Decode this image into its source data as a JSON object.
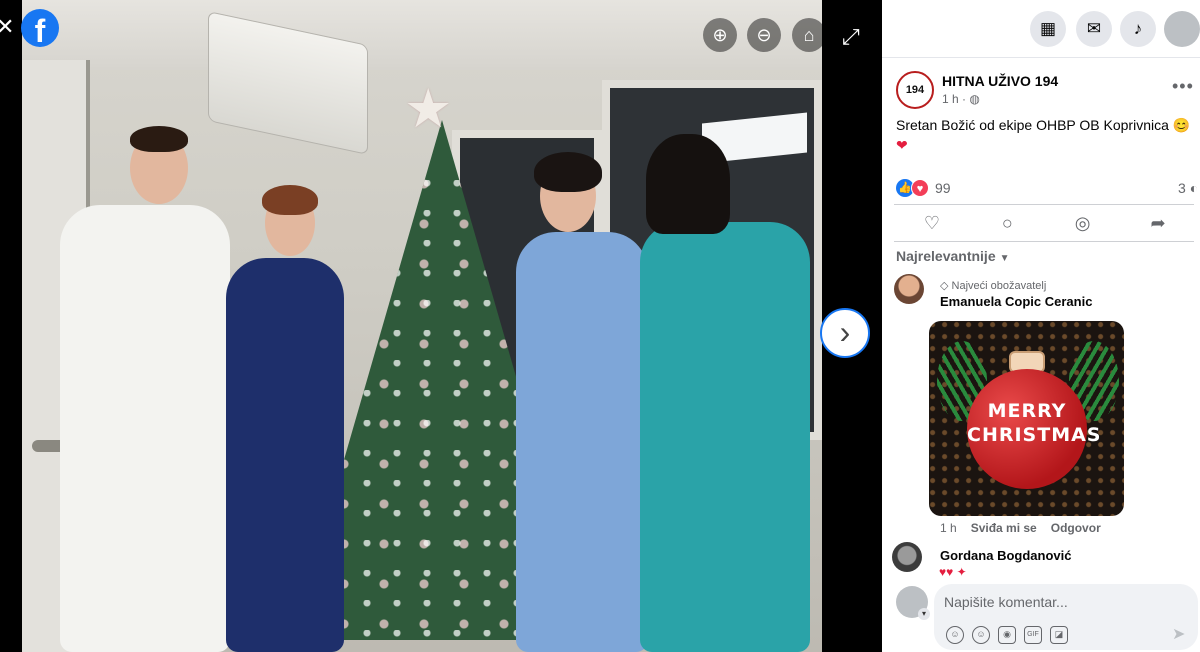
{
  "viewer": {
    "icons": [
      "close-icon",
      "facebook-logo",
      "zoom-in-icon",
      "zoom-out-icon",
      "tag-icon",
      "fullscreen-icon",
      "chevron-right-icon"
    ]
  },
  "topbar": {
    "icons": [
      "menu-grid-icon",
      "messenger-icon",
      "notifications-bell-icon",
      "account-avatar"
    ]
  },
  "post": {
    "page_name": "HITNA UŽIVO 194",
    "avatar_text": "194",
    "time": "1 h ·",
    "caption": "Sretan Božić od ekipe OHBP OB Koprivnica",
    "reaction_count": "99",
    "comment_count": "3",
    "accent_color": "#1877f2",
    "love_color": "#f33e58"
  },
  "comments": {
    "sort_label": "Najrelevantnije",
    "items": [
      {
        "badge": "Najveći obožavatelj",
        "author": "Emanuela Copic Ceranic",
        "sticker_line1": "MERRY",
        "sticker_line2": "CHRISTMAS",
        "time": "1 h",
        "like_label": "Sviđa mi se",
        "reply_label": "Odgovor"
      },
      {
        "author": "Gordana Bogdanović"
      }
    ]
  },
  "composer": {
    "placeholder": "Napišite komentar..."
  }
}
